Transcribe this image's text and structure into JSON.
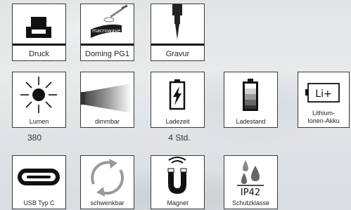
{
  "rows": [
    {
      "tiles": [
        {
          "name": "druck",
          "label": "Druck",
          "icon": "printer-icon"
        },
        {
          "name": "doming",
          "label": "Doming PG1",
          "icon": "doming-dome-icon",
          "brand": "macrowave"
        },
        {
          "name": "gravur",
          "label": "Gravur",
          "icon": "engraving-needle-icon"
        }
      ]
    },
    {
      "tiles": [
        {
          "name": "lumen",
          "label": "Lumen",
          "icon": "sun-icon",
          "value": "380"
        },
        {
          "name": "dimmbar",
          "label": "dimmbar",
          "icon": "light-beam-icon"
        },
        {
          "name": "ladezeit",
          "label": "Ladezeit",
          "icon": "battery-charging-icon",
          "value": "4 Std."
        },
        {
          "name": "ladestand",
          "label": "Ladestand",
          "icon": "battery-level-icon"
        },
        {
          "name": "akku",
          "label": "Lithium-\nIonen-Akku",
          "label_line1": "Lithium-",
          "label_line2": "Ionen-Akku",
          "icon": "li-ion-battery-icon",
          "badge": "Li+"
        }
      ]
    },
    {
      "tiles": [
        {
          "name": "usbc",
          "label": "USB Typ C",
          "icon": "usb-c-port-icon"
        },
        {
          "name": "schwenkbar",
          "label": "schwenkbar",
          "icon": "rotate-arrows-icon"
        },
        {
          "name": "magnet",
          "label": "Magnet",
          "icon": "magnet-icon"
        },
        {
          "name": "schutzklasse",
          "label": "Schutzklasse",
          "icon": "water-drops-icon",
          "badge": "IP42"
        }
      ]
    }
  ]
}
